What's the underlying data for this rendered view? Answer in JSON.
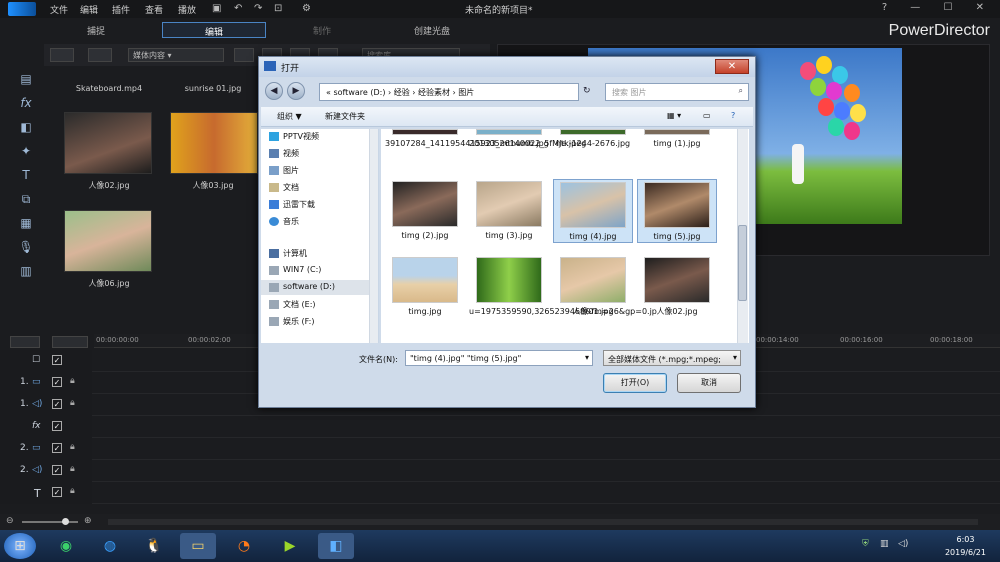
{
  "menubar": {
    "items": [
      "文件",
      "编辑",
      "插件",
      "查看",
      "播放"
    ],
    "project_title": "未命名的新项目*",
    "window_controls": "? — ☐ ✕"
  },
  "brand": "PowerDirector",
  "mode_tabs": [
    "捕捉",
    "编辑",
    "制作",
    "创建光盘"
  ],
  "library": {
    "filter": "媒体内容",
    "search_placeholder": "搜索库",
    "items": [
      {
        "label": "Skateboard.mp4"
      },
      {
        "label": "sunrise 01.jpg"
      },
      {
        "label": "人像02.jpg"
      },
      {
        "label": "人像03.jpg"
      },
      {
        "label": "人像06.jpg"
      }
    ]
  },
  "timeline": {
    "ruler": [
      "00:00:00:00",
      "00:00:02:00",
      "00:00:14:00",
      "00:00:16:00",
      "00:00:18:00"
    ],
    "tracks": [
      {
        "label": "",
        "icon": "select-all"
      },
      {
        "label": "1.",
        "icon": "video-track-icon"
      },
      {
        "label": "1.",
        "icon": "audio-track-icon"
      },
      {
        "label": "fx",
        "icon": "fx-track-icon"
      },
      {
        "label": "2.",
        "icon": "video-track-icon"
      },
      {
        "label": "2.",
        "icon": "audio-track-icon"
      },
      {
        "label": "T",
        "icon": "title-track-icon"
      }
    ]
  },
  "dialog": {
    "title": "打开",
    "address": "« software (D:) › 经验 › 经验素材 › 图片",
    "search_placeholder": "搜索 图片",
    "organize": "组织 ▼",
    "new_folder": "新建文件夹",
    "nav": [
      "PPTV视频",
      "视频",
      "图片",
      "文档",
      "迅雷下载",
      "音乐",
      "计算机",
      "WIN7 (C:)",
      "software (D:)",
      "文档 (E:)",
      "娱乐 (F:)"
    ],
    "files": [
      {
        "name": "39107284_1411954415923_mthumb.jpg",
        "selected": false
      },
      {
        "name": "20130526140022_5fMJe.jpeg",
        "selected": false
      },
      {
        "name": "ntk-1244-2676.jpg",
        "selected": false
      },
      {
        "name": "timg (1).jpg",
        "selected": false
      },
      {
        "name": "timg (2).jpg",
        "selected": false
      },
      {
        "name": "timg (3).jpg",
        "selected": false
      },
      {
        "name": "timg (4).jpg",
        "selected": true
      },
      {
        "name": "timg (5).jpg",
        "selected": true
      },
      {
        "name": "timg.jpg",
        "selected": false
      },
      {
        "name": "u=1975359590,3265239468&fm=26&gp=0.jp",
        "selected": false
      },
      {
        "name": "人像01.jpg",
        "selected": false
      },
      {
        "name": "人像02.jpg",
        "selected": false
      }
    ],
    "filename_label": "文件名(N):",
    "filename_value": "\"timg (4).jpg\" \"timg (5).jpg\"",
    "filetype": "全部媒体文件 (*.mpg;*.mpeg;",
    "open": "打开(O)",
    "cancel": "取消"
  },
  "taskbar": {
    "time": "6:03",
    "date": "2019/6/21"
  }
}
